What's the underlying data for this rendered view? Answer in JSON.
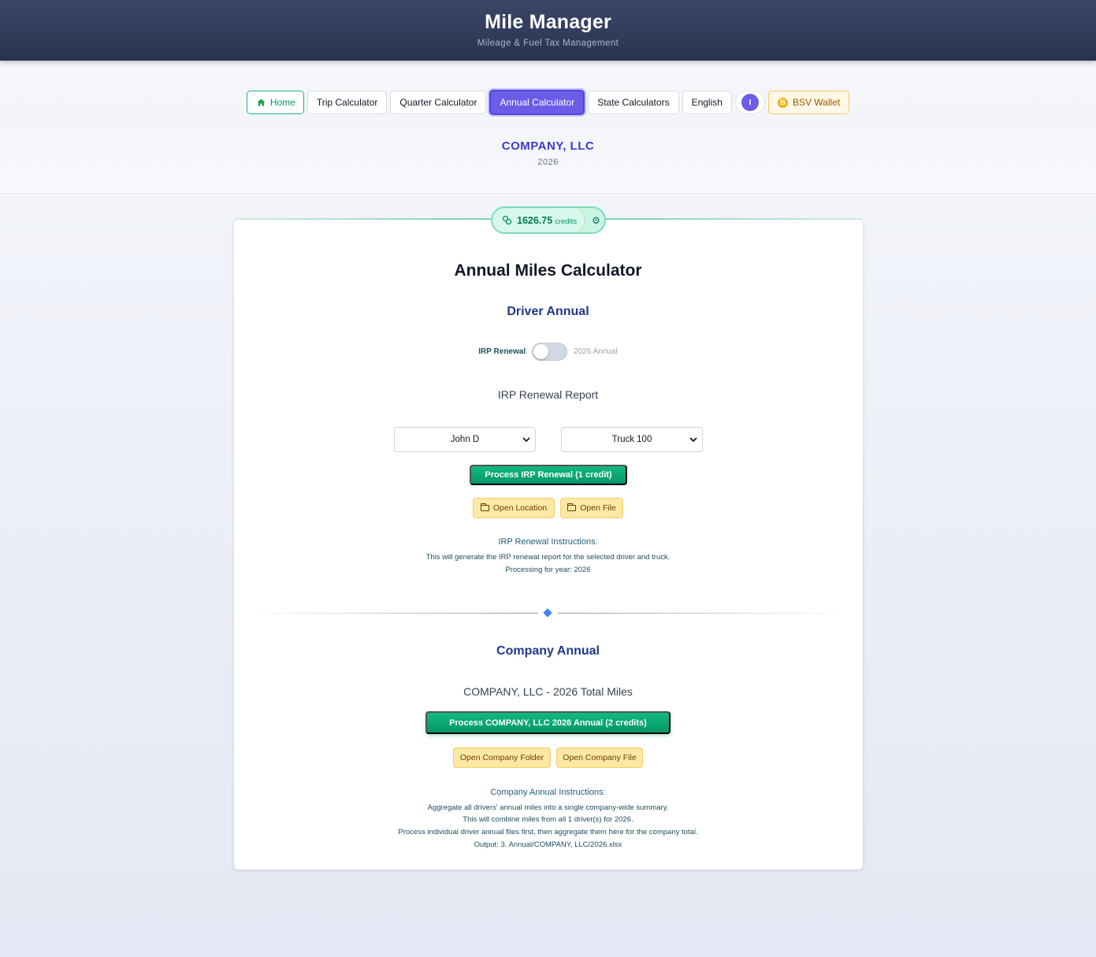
{
  "app": {
    "title": "Mile Manager",
    "subtitle": "Mileage & Fuel Tax Management"
  },
  "nav": {
    "home": "Home",
    "trip": "Trip Calculator",
    "quarter": "Quarter Calculator",
    "annual": "Annual Calculator",
    "state": "State Calculators",
    "language": "English",
    "avatar_initial": "I",
    "wallet": "BSV Wallet",
    "wallet_coin": "B"
  },
  "company": {
    "name": "COMPANY, LLC",
    "year": "2026"
  },
  "credits": {
    "value": "1626.75",
    "unit": "credits"
  },
  "calculator": {
    "title": "Annual Miles Calculator"
  },
  "driver_annual": {
    "title": "Driver Annual",
    "toggle_left": "IRP Renewal",
    "toggle_right": "2026 Annual",
    "toggle_on": false,
    "report_title": "IRP Renewal Report",
    "driver_select": "John D",
    "truck_select": "Truck 100",
    "process_button": "Process IRP Renewal (1 credit)",
    "open_location": "Open Location",
    "open_file": "Open File",
    "instructions_title": "IRP Renewal Instructions:",
    "instructions": [
      "This will generate the IRP renewal report for the selected driver and truck.",
      "Processing for year: 2026"
    ]
  },
  "company_annual": {
    "title": "Company Annual",
    "report_title": "COMPANY, LLC - 2026 Total Miles",
    "process_button": "Process COMPANY, LLC 2026 Annual (2 credits)",
    "open_folder": "Open Company Folder",
    "open_file": "Open Company File",
    "instructions_title": "Company Annual Instructions:",
    "instructions": [
      "Aggregate all drivers' annual miles into a single company-wide summary.",
      "This will combine miles from all 1 driver(s) for 2026.",
      "Process individual driver annual files first, then aggregate them here for the company total.",
      "Output: 3. Annual/COMPANY, LLC/2026.xlsx"
    ]
  },
  "colors": {
    "header_bg": "#2f3856",
    "accent_purple": "#6d5ce7",
    "accent_green": "#10b981",
    "title_blue": "#1e3a8a",
    "company_purple": "#4338ca"
  }
}
